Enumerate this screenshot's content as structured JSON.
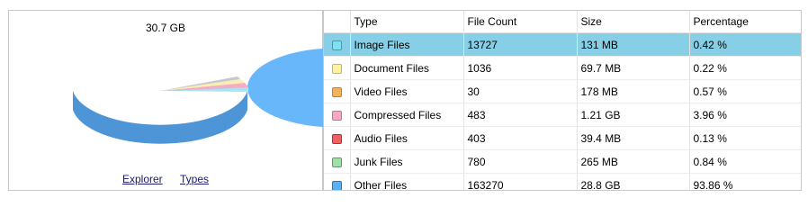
{
  "left": {
    "total_size": "30.7 GB",
    "links": {
      "explorer": "Explorer",
      "types": "Types"
    }
  },
  "table": {
    "headers": {
      "type": "Type",
      "count": "File Count",
      "size": "Size",
      "percentage": "Percentage"
    },
    "rows": [
      {
        "type": "Image Files",
        "count": "13727",
        "size": "131 MB",
        "percentage": "0.42 %",
        "color": "#7fe0f0",
        "border": "#2aa8c2",
        "selected": true
      },
      {
        "type": "Document Files",
        "count": "1036",
        "size": "69.7 MB",
        "percentage": "0.22 %",
        "color": "#fff3a0",
        "border": "#c9b84a"
      },
      {
        "type": "Video Files",
        "count": "30",
        "size": "178 MB",
        "percentage": "0.57 %",
        "color": "#f3b35a",
        "border": "#c4802a"
      },
      {
        "type": "Compressed Files",
        "count": "483",
        "size": "1.21 GB",
        "percentage": "3.96 %",
        "color": "#f7a9c4",
        "border": "#cf6f92"
      },
      {
        "type": "Audio Files",
        "count": "403",
        "size": "39.4 MB",
        "percentage": "0.13 %",
        "color": "#f06262",
        "border": "#b82e2e"
      },
      {
        "type": "Junk Files",
        "count": "780",
        "size": "265 MB",
        "percentage": "0.84 %",
        "color": "#9fe0a8",
        "border": "#4ca55a"
      },
      {
        "type": "Other Files",
        "count": "163270",
        "size": "28.8 GB",
        "percentage": "93.86 %",
        "color": "#5ab0f5",
        "border": "#2a78c0"
      }
    ]
  },
  "pie_colors": {
    "main_top": "#69b7fb",
    "main_side": "#4d95d6",
    "compressed": "#f7abc6",
    "document": "#f7f0b2",
    "image": "#a9e4f2",
    "other_small": "#c9c9c9"
  }
}
